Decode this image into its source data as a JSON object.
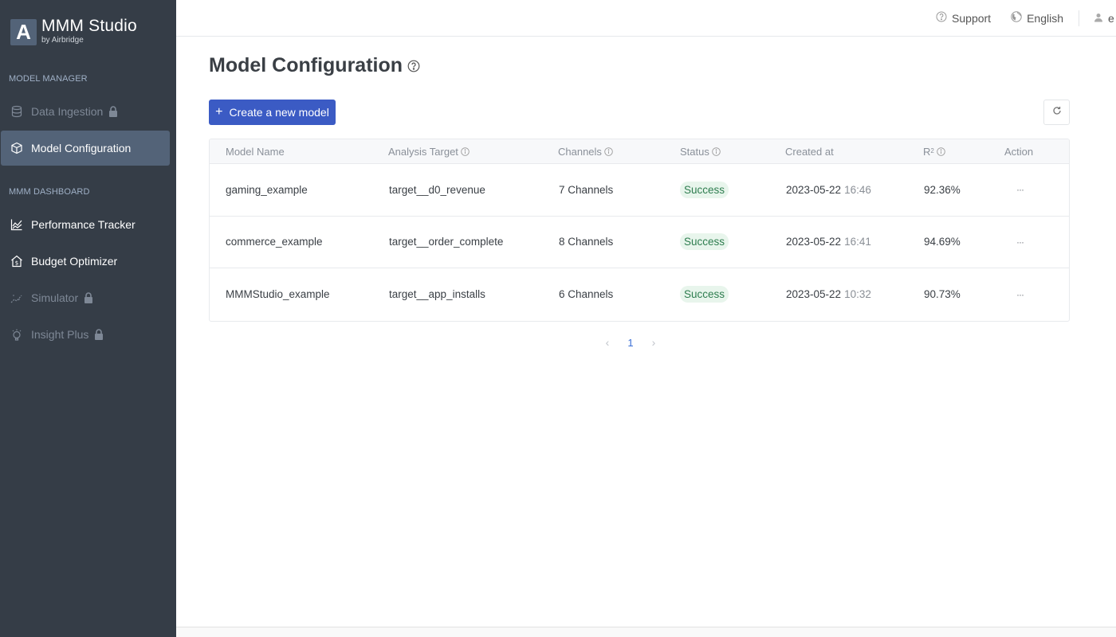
{
  "app": {
    "logo_letter": "A",
    "title": "MMM Studio",
    "subtitle": "by Airbridge"
  },
  "sidebar": {
    "sections": [
      {
        "label": "MODEL MANAGER",
        "items": [
          {
            "label": "Data Ingestion",
            "icon": "database-icon",
            "locked": true,
            "active": false
          },
          {
            "label": "Model Configuration",
            "icon": "cube-icon",
            "locked": false,
            "active": true
          }
        ]
      },
      {
        "label": "MMM DASHBOARD",
        "items": [
          {
            "label": "Performance Tracker",
            "icon": "line-chart-icon",
            "locked": false,
            "active": false
          },
          {
            "label": "Budget Optimizer",
            "icon": "budget-house-icon",
            "locked": false,
            "active": false
          },
          {
            "label": "Simulator",
            "icon": "scatter-trend-icon",
            "locked": true,
            "active": false
          },
          {
            "label": "Insight Plus",
            "icon": "lightbulb-icon",
            "locked": true,
            "active": false
          }
        ]
      }
    ]
  },
  "topbar": {
    "support_label": "Support",
    "language_label": "English",
    "user_label": "e"
  },
  "main": {
    "page_title": "Model Configuration",
    "create_button_label": "Create a new model",
    "create_button_icon": "+",
    "table": {
      "columns": [
        {
          "label": "Model Name",
          "info": false
        },
        {
          "label": "Analysis Target",
          "info": true
        },
        {
          "label": "Channels",
          "info": true
        },
        {
          "label": "Status",
          "info": true
        },
        {
          "label": "Created at",
          "info": false
        },
        {
          "label": "R",
          "sup": "2",
          "info": true
        },
        {
          "label": "Action",
          "info": false
        }
      ],
      "rows": [
        {
          "model_name": "gaming_example",
          "analysis_target": "target__d0_revenue",
          "channels": "7 Channels",
          "status": "Success",
          "created_date": "2023-05-22",
          "created_time": "16:46",
          "r2": "92.36%",
          "action": "···"
        },
        {
          "model_name": "commerce_example",
          "analysis_target": "target__order_complete",
          "channels": "8 Channels",
          "status": "Success",
          "created_date": "2023-05-22",
          "created_time": "16:41",
          "r2": "94.69%",
          "action": "···"
        },
        {
          "model_name": "MMMStudio_example",
          "analysis_target": "target__app_installs",
          "channels": "6 Channels",
          "status": "Success",
          "created_date": "2023-05-22",
          "created_time": "10:32",
          "r2": "90.73%",
          "action": "···"
        }
      ]
    },
    "pagination": {
      "prev": "‹",
      "current_page": "1",
      "next": "›"
    }
  },
  "colors": {
    "sidebar_bg": "#353d47",
    "active_item_bg": "#536378",
    "primary": "#3b5bc4",
    "success_bg": "#e8f5ec",
    "success_text": "#2e7d4f",
    "page_link": "#3b6fd6"
  }
}
